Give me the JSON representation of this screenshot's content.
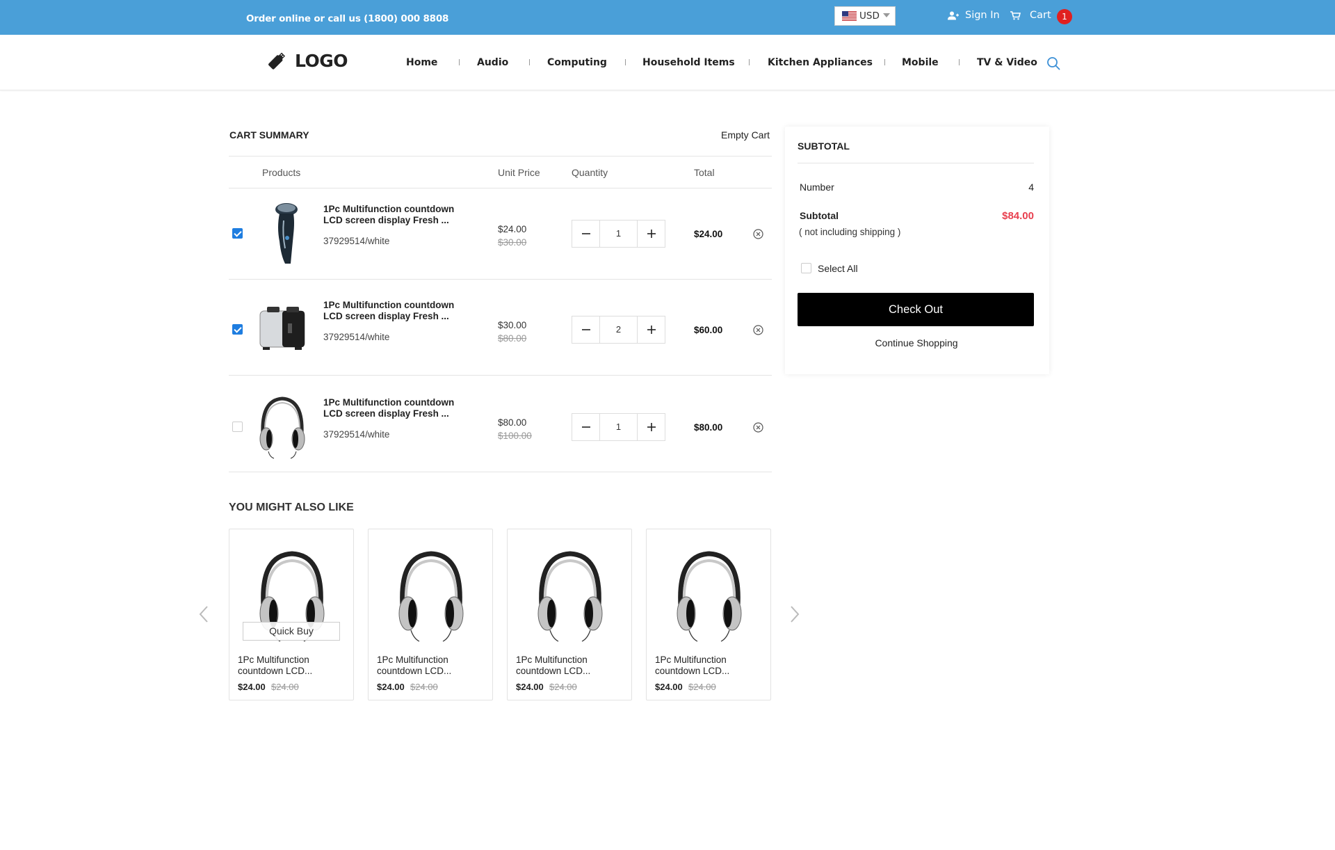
{
  "topbar": {
    "phone_text": "Order online or call us (1800) 000 8808",
    "currency": "USD",
    "sign_in": "Sign In",
    "cart_label": "Cart",
    "cart_count": "1"
  },
  "nav": {
    "logo": "LOGO",
    "items": [
      "Home",
      "Audio",
      "Computing",
      "Household Items",
      "Kitchen Appliances",
      "Mobile",
      "TV & Video"
    ]
  },
  "cart": {
    "title": "CART SUMMARY",
    "empty_label": "Empty Cart",
    "columns": [
      "Products",
      "Unit Price",
      "Quantity",
      "Total"
    ],
    "items": [
      {
        "name": "1Pc Multifunction countdown LCD screen display Fresh ...",
        "sku": "37929514/white",
        "price": "$24.00",
        "old_price": "$30.00",
        "qty": "1",
        "total": "$24.00",
        "checked": true,
        "image": "shaver-icon"
      },
      {
        "name": "1Pc Multifunction countdown LCD screen display Fresh ...",
        "sku": "37929514/white",
        "price": "$30.00",
        "old_price": "$80.00",
        "qty": "2",
        "total": "$60.00",
        "checked": true,
        "image": "toaster-icon"
      },
      {
        "name": "1Pc Multifunction countdown LCD screen display Fresh ...",
        "sku": "37929514/white",
        "price": "$80.00",
        "old_price": "$100.00",
        "qty": "1",
        "total": "$80.00",
        "checked": false,
        "image": "headphones-icon"
      }
    ]
  },
  "recommend": {
    "title": "YOU MIGHT ALSO LIKE",
    "quick_buy": "Quick Buy",
    "items": [
      {
        "name": "1Pc Multifunction countdown LCD...",
        "price": "$24.00",
        "old_price": "$24.00"
      },
      {
        "name": "1Pc Multifunction countdown LCD...",
        "price": "$24.00",
        "old_price": "$24.00"
      },
      {
        "name": "1Pc Multifunction countdown LCD...",
        "price": "$24.00",
        "old_price": "$24.00"
      },
      {
        "name": "1Pc Multifunction countdown LCD...",
        "price": "$24.00",
        "old_price": "$24.00"
      }
    ]
  },
  "summary": {
    "title": "SUBTOTAL",
    "number_label": "Number",
    "number_value": "4",
    "subtotal_label": "Subtotal",
    "subtotal_value": "$84.00",
    "shipping_note": "( not including shipping )",
    "select_all": "Select All",
    "checkout": "Check Out",
    "continue": "Continue Shopping"
  },
  "colors": {
    "topbar": "#4a9fd8",
    "accent_blue": "#1e7de0",
    "subtotal_red": "#e8404f",
    "badge_red": "#e02020"
  }
}
